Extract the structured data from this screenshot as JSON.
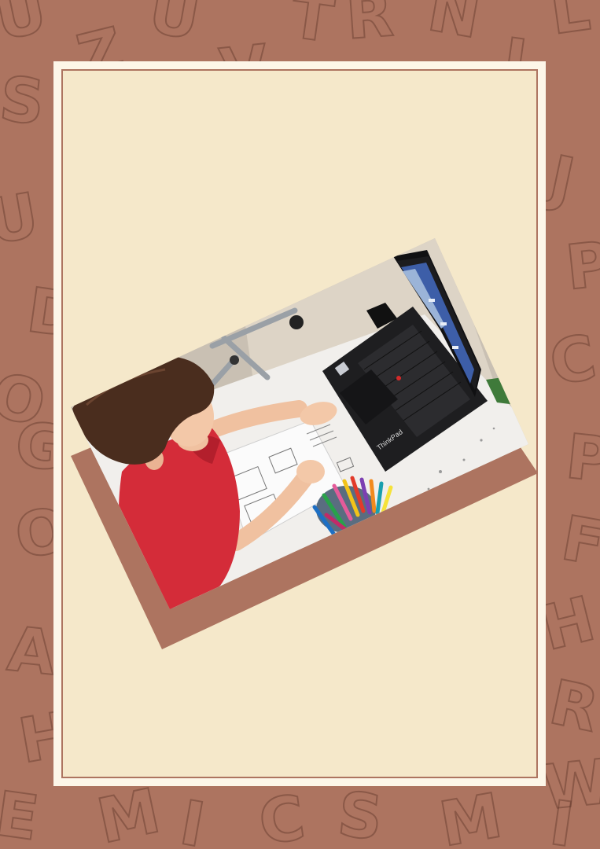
{
  "theme": {
    "background_color": "#ad7460",
    "card_color": "#f5e8ca",
    "card_border_color": "#ad7460",
    "photo_backing_color": "#ad7460"
  },
  "background_pattern": {
    "style": "outlined sketch alphabet letters",
    "letters": [
      "U",
      "T",
      "R",
      "N",
      "L",
      "S",
      "U",
      "J",
      "P",
      "D",
      "C",
      "O",
      "P",
      "O",
      "F",
      "H",
      "A",
      "R",
      "H",
      "W",
      "E",
      "M",
      "I",
      "C",
      "S",
      "M",
      "I",
      "U",
      "Z",
      "I",
      "V",
      "G"
    ]
  },
  "photo": {
    "description_icon": "photo-icon",
    "laptop_brand_label": "ThinkPad"
  }
}
